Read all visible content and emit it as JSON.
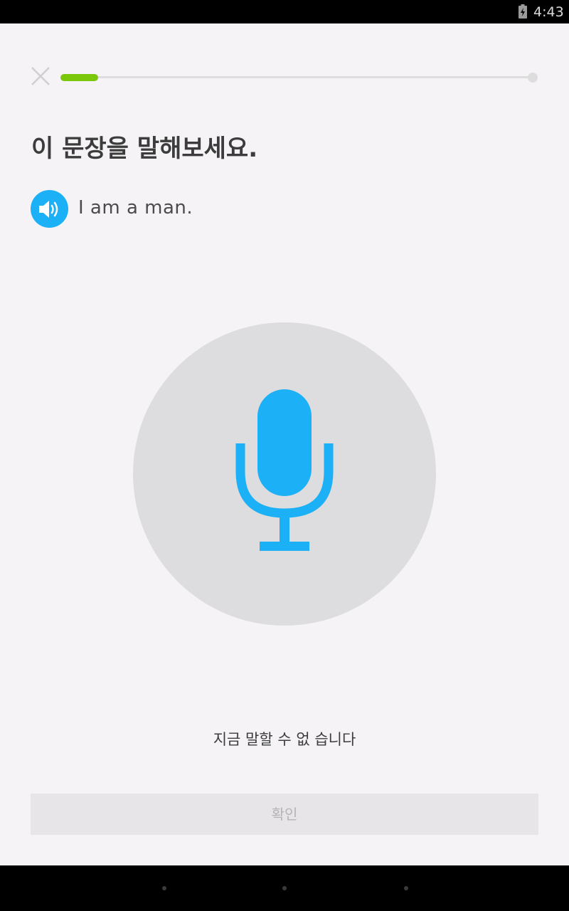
{
  "status_bar": {
    "time": "4:43",
    "battery_icon": "battery-charging-icon"
  },
  "lesson": {
    "close_icon": "close-icon",
    "progress": 0.08,
    "progress_color": "#7ac70c",
    "prompt_title": "이 문장을 말해보세요.",
    "speaker_icon": "speaker-icon",
    "sentence": "I am a man.",
    "mic_icon": "microphone-icon",
    "accent_color": "#1cb0f6",
    "cant_speak_label": "지금 말할 수 없 습니다",
    "check_button_label": "확인"
  },
  "nav_bar": {
    "items": [
      "back",
      "home",
      "recents"
    ]
  }
}
